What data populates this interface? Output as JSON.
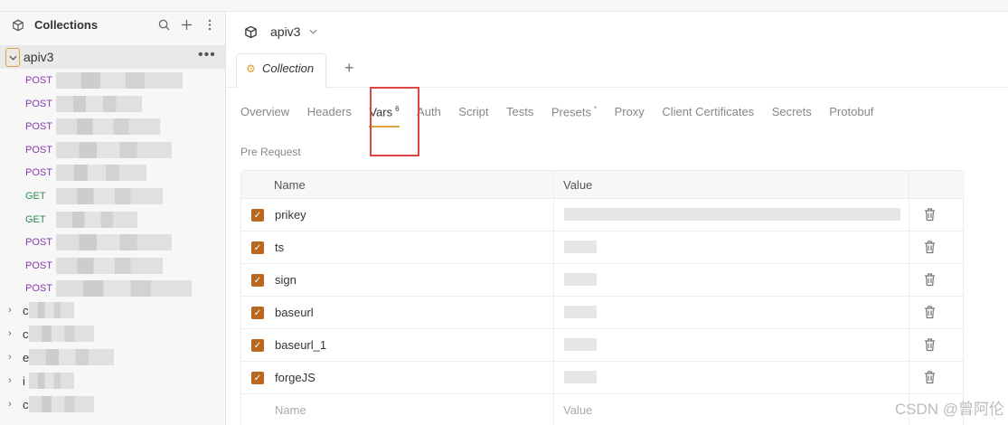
{
  "sidebar": {
    "title": "Collections",
    "root": {
      "label": "apiv3"
    },
    "requests": [
      {
        "method": "POST",
        "type": "post",
        "blur_width": 140
      },
      {
        "method": "POST",
        "type": "post",
        "blur_width": 95
      },
      {
        "method": "POST",
        "type": "post",
        "blur_width": 115
      },
      {
        "method": "POST",
        "type": "post",
        "blur_width": 128
      },
      {
        "method": "POST",
        "type": "post",
        "blur_width": 100
      },
      {
        "method": "GET",
        "type": "get",
        "blur_width": 118
      },
      {
        "method": "GET",
        "type": "get",
        "blur_width": 90
      },
      {
        "method": "POST",
        "type": "post",
        "blur_width": 128
      },
      {
        "method": "POST",
        "type": "post",
        "blur_width": 118
      },
      {
        "method": "POST",
        "type": "post",
        "blur_width": 150
      }
    ],
    "folders": [
      {
        "label": "c"
      },
      {
        "label": "c"
      },
      {
        "label": "e"
      },
      {
        "label": "i"
      },
      {
        "label": "c"
      }
    ]
  },
  "workspace": {
    "name": "apiv3"
  },
  "tabs": {
    "collection_tab": "Collection"
  },
  "subtabs": [
    {
      "label": "Overview"
    },
    {
      "label": "Headers"
    },
    {
      "label": "Vars",
      "badge": "6",
      "active": true
    },
    {
      "label": "Auth"
    },
    {
      "label": "Script"
    },
    {
      "label": "Tests"
    },
    {
      "label": "Presets",
      "badge": "*"
    },
    {
      "label": "Proxy"
    },
    {
      "label": "Client Certificates"
    },
    {
      "label": "Secrets"
    },
    {
      "label": "Protobuf"
    }
  ],
  "section_label": "Pre Request",
  "table": {
    "col_name": "Name",
    "col_value": "Value",
    "rows": [
      {
        "name": "prikey",
        "checked": true,
        "value_blur": 372
      },
      {
        "name": "ts",
        "checked": true,
        "value_blur": 36
      },
      {
        "name": "sign",
        "checked": true,
        "value_blur": 36
      },
      {
        "name": "baseurl",
        "checked": true,
        "value_blur": 36
      },
      {
        "name": "baseurl_1",
        "checked": true,
        "value_blur": 36
      },
      {
        "name": "forgeJS",
        "checked": true,
        "value_blur": 36
      }
    ],
    "placeholder_name": "Name",
    "placeholder_value": "Value"
  },
  "watermark": "CSDN @曾阿伦",
  "colors": {
    "accent": "#e0a23a",
    "checkbox": "#b8691f",
    "highlight": "#e04545",
    "post": "#8a3ab0",
    "get": "#2e8b57"
  }
}
